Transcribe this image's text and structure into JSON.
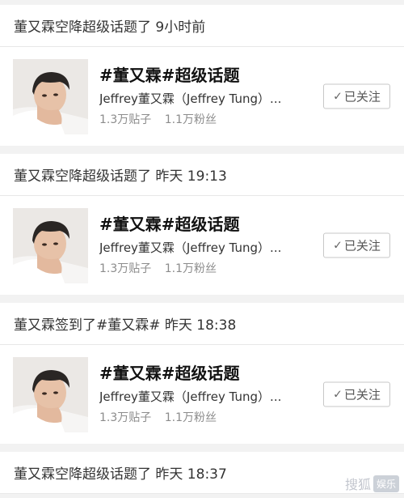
{
  "feed": {
    "items": [
      {
        "header": "董又霖空降超级话题了 9小时前",
        "topic": {
          "title": "#董又霖#超级话题",
          "description": "Jeffrey董又霖（Jeffrey Tung）...",
          "posts": "1.3万贴子",
          "fans": "1.1万粉丝",
          "follow_label": "已关注",
          "follow_icon": "check-icon"
        }
      },
      {
        "header": "董又霖空降超级话题了 昨天 19:13",
        "topic": {
          "title": "#董又霖#超级话题",
          "description": "Jeffrey董又霖（Jeffrey Tung）...",
          "posts": "1.3万贴子",
          "fans": "1.1万粉丝",
          "follow_label": "已关注",
          "follow_icon": "check-icon"
        }
      },
      {
        "header": "董又霖签到了#董又霖# 昨天 18:38",
        "topic": {
          "title": "#董又霖#超级话题",
          "description": "Jeffrey董又霖（Jeffrey Tung）...",
          "posts": "1.3万贴子",
          "fans": "1.1万粉丝",
          "follow_label": "已关注",
          "follow_icon": "check-icon"
        }
      },
      {
        "header": "董又霖空降超级话题了 昨天 18:37"
      }
    ]
  },
  "watermark": {
    "text": "搜狐",
    "badge": "娱乐"
  },
  "colors": {
    "background": "#f2f2f2",
    "card": "#ffffff",
    "title": "#111111",
    "muted": "#8c8c8c",
    "button_border": "#c7c7c7"
  }
}
